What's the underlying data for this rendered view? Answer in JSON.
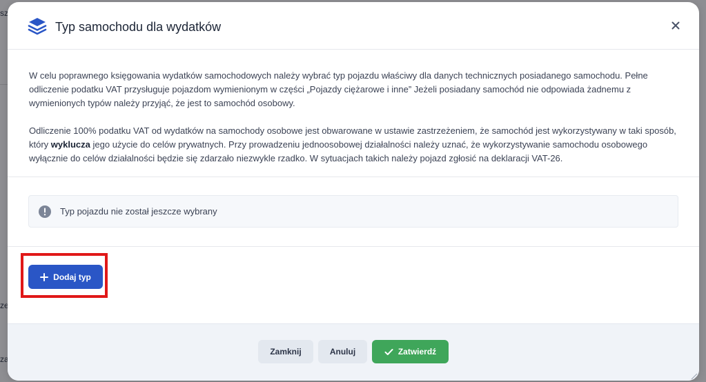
{
  "background": {
    "fragments": [
      "szc",
      "ze",
      "za"
    ]
  },
  "modal": {
    "title": "Typ samochodu dla wydatków",
    "description": {
      "p1": "W celu poprawnego księgowania wydatków samochodowych należy wybrać typ pojazdu właściwy dla danych technicznych posiadanego samochodu. Pełne odliczenie podatku VAT przysługuje pojazdom wymienionym w części „Pojazdy ciężarowe i inne” Jeżeli posiadany samochód nie odpowiada żadnemu z wymienionych typów należy przyjąć, że jest to samochód osobowy.",
      "p2_before": "Odliczenie 100% podatku VAT od wydatków na samochody osobowe jest obwarowane w ustawie zastrzeżeniem, że samochód jest wykorzystywany w taki sposób, który ",
      "p2_bold": "wyklucza",
      "p2_after": " jego użycie do celów prywatnych. Przy prowadzeniu jednoosobowej działalności należy uznać, że wykorzystywanie samochodu osobowego wyłącznie do celów działalności będzie się zdarzało niezwykle rzadko. W sytuacjach takich należy pojazd zgłosić na deklaracji VAT-26."
    },
    "status": {
      "icon": "info-icon",
      "text": "Typ pojazdu nie został jeszcze wybrany"
    },
    "add_button_label": "Dodaj typ",
    "footer": {
      "close_label": "Zamknij",
      "cancel_label": "Anuluj",
      "confirm_label": "Zatwierdź"
    }
  },
  "colors": {
    "primary": "#2a56c6",
    "success": "#3fa65a",
    "highlight": "#e01818",
    "overlay": "#8f8f93"
  }
}
